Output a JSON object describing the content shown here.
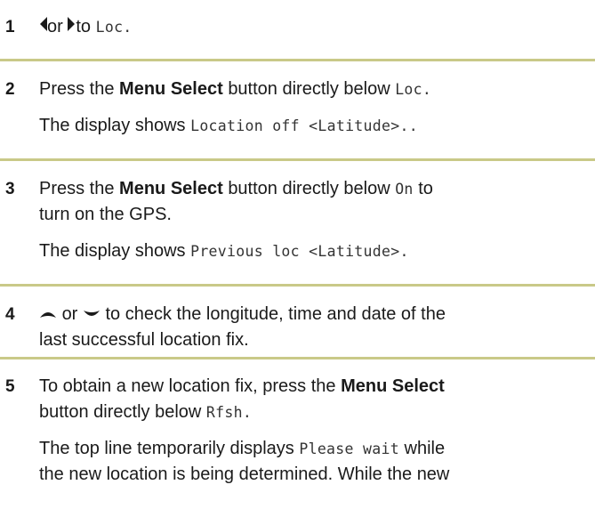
{
  "steps": [
    {
      "number": "1",
      "or": "or",
      "to": "to",
      "loc": "Loc."
    },
    {
      "number": "2",
      "p1_a": "Press the",
      "p1_b": "Menu Select",
      "p1_c": "button directly below",
      "p1_code": "Loc.",
      "p2_a": "The display shows",
      "p2_code": "Location off <Latitude>.."
    },
    {
      "number": "3",
      "p1_a": "Press the",
      "p1_b": "Menu Select",
      "p1_c": "button directly below",
      "p1_code": "On",
      "p1_d": "to",
      "p1_e": "turn on the GPS.",
      "p2_a": "The display shows",
      "p2_code": "Previous loc <Latitude>."
    },
    {
      "number": "4",
      "or": "or",
      "rest1": "to check the longitude, time and date of the",
      "rest2": "last successful location fix."
    },
    {
      "number": "5",
      "p1_line1": "To obtain a new location fix, press the",
      "p1_bold": "Menu Select",
      "p1_line2": "button directly below",
      "p1_code": "Rfsh.",
      "p2_a": "The top line temporarily displays",
      "p2_code": "Please wait",
      "p2_b": "while",
      "p2_line2": "the new location is being determined. While the new"
    }
  ],
  "icons": {
    "left": "left-arrow-icon",
    "right": "right-arrow-icon",
    "up": "up-arrow-icon",
    "down": "down-arrow-icon"
  },
  "colors": {
    "rule": "#c9c988",
    "text": "#1a1a1a"
  }
}
